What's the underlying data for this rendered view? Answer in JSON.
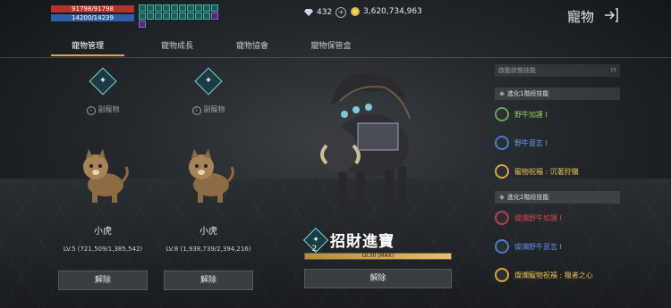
{
  "status": {
    "hp": "91798/91798",
    "mp": "14200/14239"
  },
  "currency": {
    "diamond": "432",
    "gold": "3,620,734,963"
  },
  "header": {
    "title": "寵物"
  },
  "tabs": [
    {
      "label": "寵物管理"
    },
    {
      "label": "寵物成長"
    },
    {
      "label": "寵物協會"
    },
    {
      "label": "寵物保管盒"
    }
  ],
  "slots": [
    {
      "sub_label": "副寵物",
      "name": "小虎",
      "level": "LV.5 (721,509/1,385,542)",
      "button": "解除"
    },
    {
      "sub_label": "副寵物",
      "name": "小虎",
      "level": "LV.8 (1,938,739/2,394,216)",
      "button": "解除"
    }
  ],
  "main_pet": {
    "name": "招財進寶",
    "badge_number": "2",
    "exp_text": "LV.30 (MAX)",
    "exp_percent": 100,
    "button": "解除"
  },
  "skills": {
    "top_text": "啟動狀態技能",
    "group1_title": "進化1階段技能",
    "group1": [
      {
        "name": "野牛加護 I",
        "color": "#8fd06a"
      },
      {
        "name": "野牛意志 I",
        "color": "#6b9df0"
      },
      {
        "name": "寵物祝福 : 沉著狩獵",
        "color": "#e9c15a"
      }
    ],
    "group2_title": "進化2階段技能",
    "group2": [
      {
        "name": "燦爛野牛加護 I",
        "color": "#d2424f"
      },
      {
        "name": "燦爛野牛意志 I",
        "color": "#5d8fe8"
      },
      {
        "name": "燦爛寵物祝福 : 獵者之心",
        "color": "#e9c15a"
      }
    ]
  }
}
